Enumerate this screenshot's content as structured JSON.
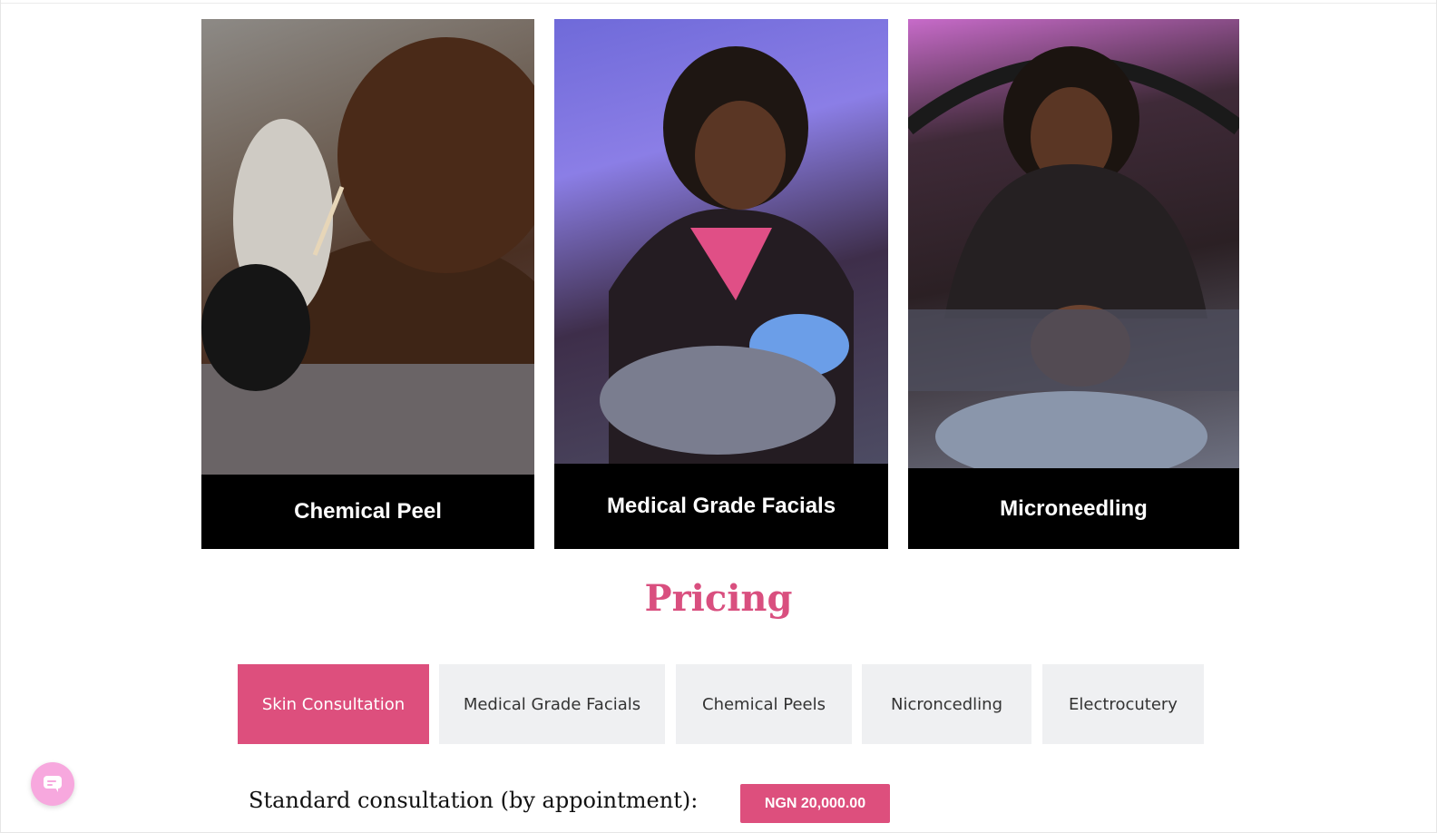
{
  "services": [
    {
      "title": "Chemical Peel"
    },
    {
      "title": "Medical Grade Facials"
    },
    {
      "title": "Microneedling"
    }
  ],
  "pricing": {
    "heading": "Pricing",
    "tabs": [
      {
        "label": "Skin Consultation",
        "active": true
      },
      {
        "label": "Medical Grade Facials",
        "active": false
      },
      {
        "label": "Chemical Peels",
        "active": false
      },
      {
        "label": "Nicroncedling",
        "active": false
      },
      {
        "label": "Electrocutery",
        "active": false
      }
    ],
    "items": [
      {
        "label": "Standard consultation (by appointment):",
        "price": "NGN 20,000.00"
      }
    ]
  },
  "chat": {
    "icon": "chat-bubble-icon"
  },
  "colors": {
    "accent": "#dd4f7d",
    "heading": "#d94f7f",
    "tab_bg": "#eff0f2",
    "chat_bg": "#f7a8de"
  }
}
